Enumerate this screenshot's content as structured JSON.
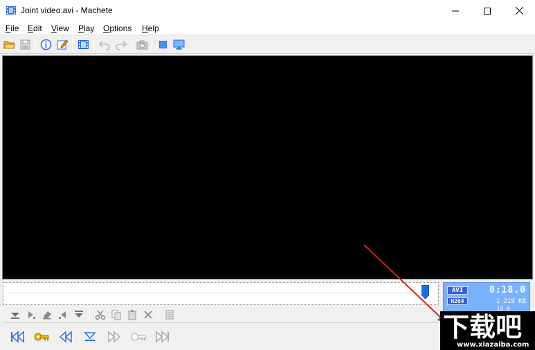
{
  "window": {
    "title": "Joint video.avi - Machete"
  },
  "menu": {
    "items": [
      {
        "underline": "F",
        "rest": "ile"
      },
      {
        "underline": "E",
        "rest": "dit"
      },
      {
        "underline": "V",
        "rest": "iew"
      },
      {
        "underline": "P",
        "rest": "lay"
      },
      {
        "underline": "O",
        "rest": "ptions"
      },
      {
        "underline": "H",
        "rest": "elp"
      }
    ]
  },
  "toolbar": {
    "icons": [
      "open-folder-icon",
      "save-icon",
      "info-icon",
      "edit-tags-icon",
      "film-frames-icon",
      "undo-icon",
      "redo-icon",
      "snapshot-icon",
      "fullscreen-icon",
      "monitor-icon"
    ]
  },
  "info_panel": {
    "format": "AVI",
    "codec": "H264",
    "time": "0:18.0",
    "size": "1 219 KB",
    "fps": "18.0"
  },
  "timeline": {
    "position_fraction": 0.98
  },
  "watermark": {
    "main": "下载吧",
    "sub": "www.xiazaiba.com"
  },
  "colors": {
    "accent_blue": "#2a6ed8",
    "key_gold": "#e0a800",
    "panel_blue": "#7ab2ff",
    "arrow_red": "#d42020"
  }
}
